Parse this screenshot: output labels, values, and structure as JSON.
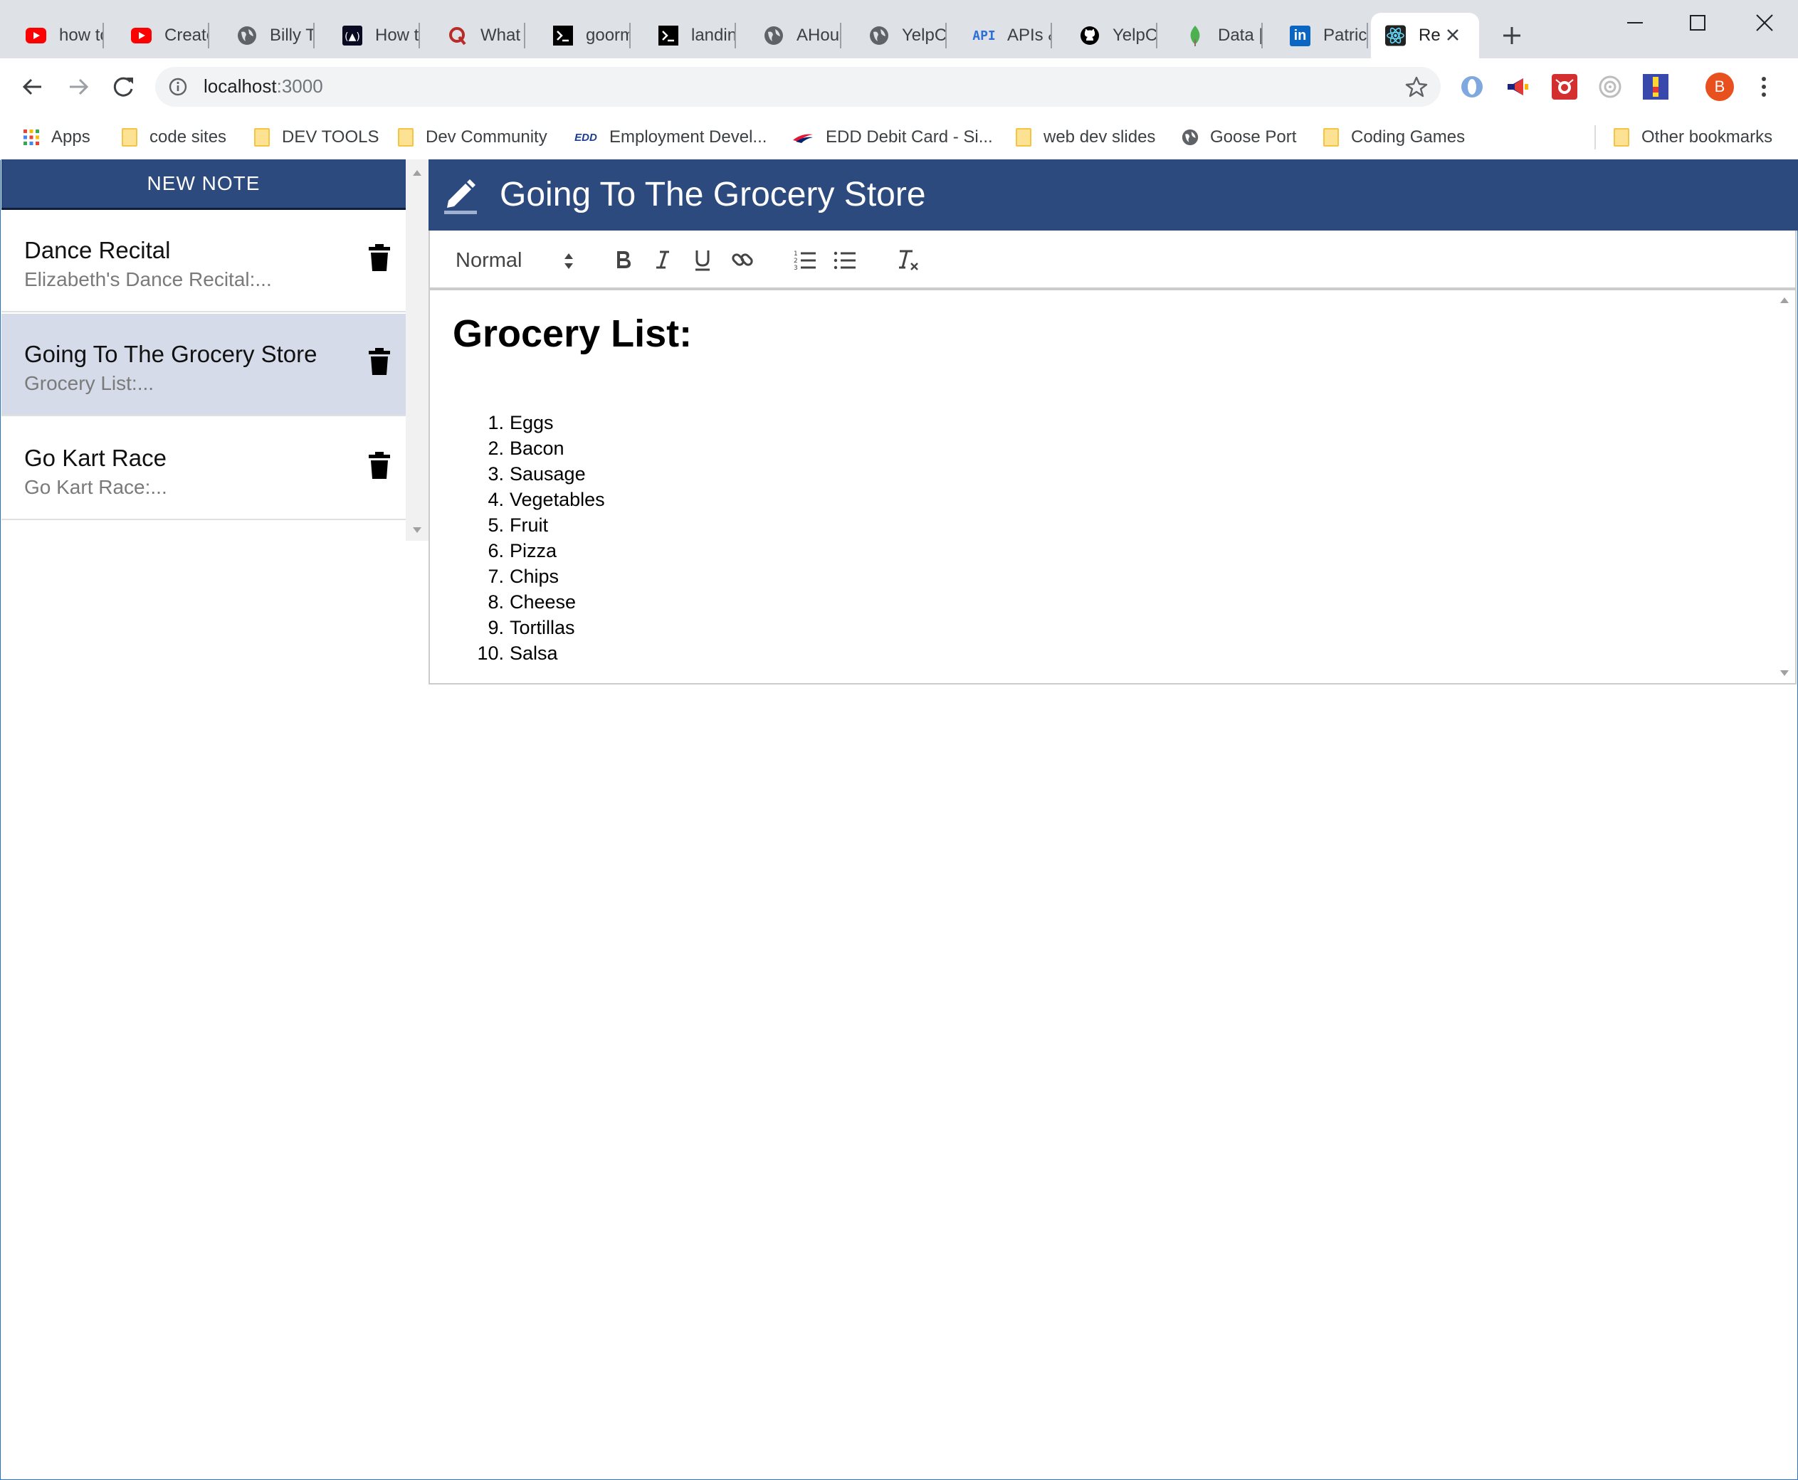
{
  "browser": {
    "tabs": [
      {
        "icon": "youtube-icon",
        "title": "how to"
      },
      {
        "icon": "youtube-icon",
        "title": "Create"
      },
      {
        "icon": "globe-icon",
        "title": "Billy To"
      },
      {
        "icon": "freecodecamp-icon",
        "title": "How to"
      },
      {
        "icon": "quora-icon",
        "title": "What a"
      },
      {
        "icon": "terminal-icon",
        "title": "goorm"
      },
      {
        "icon": "terminal-icon",
        "title": "landin"
      },
      {
        "icon": "globe-icon",
        "title": "AHous"
      },
      {
        "icon": "globe-icon",
        "title": "YelpCa"
      },
      {
        "icon": "api-icon",
        "title": "APIs &"
      },
      {
        "icon": "github-icon",
        "title": "YelpCa"
      },
      {
        "icon": "mongodb-icon",
        "title": "Data |"
      },
      {
        "icon": "linkedin-icon",
        "title": "Patrick"
      },
      {
        "icon": "react-icon",
        "title": "Re"
      }
    ],
    "address": {
      "host": "localhost",
      "port": ":3000"
    },
    "profile_initial": "B",
    "bookmarks": [
      {
        "icon": "apps-grid-icon",
        "label": "Apps"
      },
      {
        "icon": "folder-icon",
        "label": "code sites"
      },
      {
        "icon": "folder-icon",
        "label": "DEV TOOLS"
      },
      {
        "icon": "folder-icon",
        "label": "Dev Community"
      },
      {
        "icon": "edd-icon",
        "label": "Employment Devel..."
      },
      {
        "icon": "bank-icon",
        "label": "EDD Debit Card - Si..."
      },
      {
        "icon": "folder-icon",
        "label": "web dev slides"
      },
      {
        "icon": "globe-icon",
        "label": "Goose Port"
      },
      {
        "icon": "folder-icon",
        "label": "Coding Games"
      }
    ],
    "other_bookmarks": "Other bookmarks",
    "edd_icon_text": "EDD",
    "api_icon_text": "API",
    "linkedin_icon_text": "in"
  },
  "app": {
    "new_note_label": "NEW NOTE",
    "notes": [
      {
        "title": "Dance Recital",
        "preview": "Elizabeth's Dance Recital:..."
      },
      {
        "title": "Going To The Grocery Store",
        "preview": "Grocery List:..."
      },
      {
        "title": "Go Kart Race",
        "preview": "Go Kart Race:..."
      }
    ],
    "selected_note_index": 1,
    "editor": {
      "title": "Going To The Grocery Store",
      "format_value": "Normal",
      "heading": "Grocery List:",
      "list": [
        {
          "n": "1.",
          "text": "Eggs"
        },
        {
          "n": "2.",
          "text": "Bacon"
        },
        {
          "n": "3.",
          "text": "Sausage"
        },
        {
          "n": "4.",
          "text": "Vegetables"
        },
        {
          "n": "5.",
          "text": "Fruit"
        },
        {
          "n": "6.",
          "text": "Pizza"
        },
        {
          "n": "7.",
          "text": "Chips"
        },
        {
          "n": "8.",
          "text": "Cheese"
        },
        {
          "n": "9.",
          "text": "Tortillas"
        },
        {
          "n": "10.",
          "text": "Salsa"
        }
      ]
    }
  },
  "colors": {
    "header_blue": "#2c4a7e",
    "selected_note_bg": "#d6dbe9",
    "profile_orange": "#e8501e"
  }
}
